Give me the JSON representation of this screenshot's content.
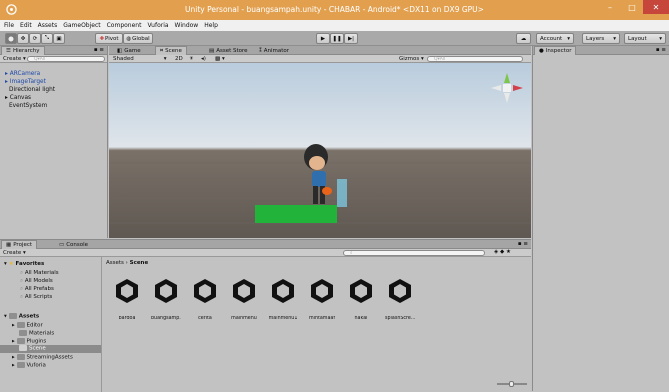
{
  "window": {
    "title": "Unity Personal - buangsampah.unity - CHABAR - Android* <DX11 on DX9 GPU>"
  },
  "menu": [
    "File",
    "Edit",
    "Assets",
    "GameObject",
    "Component",
    "Vuforia",
    "Window",
    "Help"
  ],
  "toolbar": {
    "pivot": "Pivot",
    "global": "Global",
    "account": "Account",
    "layers": "Layers",
    "layout": "Layout"
  },
  "hierarchy": {
    "tab": "Hierarchy",
    "create": "Create",
    "search_placeholder": "Q▾All",
    "items": [
      "ARCamera",
      "ImageTarget",
      "Directional light",
      "Canvas",
      "EventSystem"
    ]
  },
  "scene": {
    "tabs": [
      "Game",
      "Scene",
      "Asset Store",
      "Animator"
    ],
    "shaded": "Shaded",
    "mode2d": "2D",
    "gizmos": "Gizmos",
    "search_placeholder": "Q▾All"
  },
  "inspector": {
    "tab": "Inspector"
  },
  "project": {
    "tabs": [
      "Project",
      "Console"
    ],
    "create": "Create",
    "breadcrumb_root": "Assets",
    "breadcrumb_sep": "›",
    "breadcrumb_current": "Scene",
    "favorites": {
      "label": "Favorites",
      "items": [
        "All Materials",
        "All Models",
        "All Prefabs",
        "All Scripts"
      ]
    },
    "assets": {
      "label": "Assets",
      "folders": [
        "Editor",
        "Materials",
        "Plugins",
        "Scene",
        "StreamingAssets",
        "Vuforia"
      ]
    },
    "files": [
      "bardoa",
      "buangsamp...",
      "cerita",
      "mainmenu",
      "mainmenu1",
      "mintamaaf",
      "nakal",
      "splashScre..."
    ]
  }
}
